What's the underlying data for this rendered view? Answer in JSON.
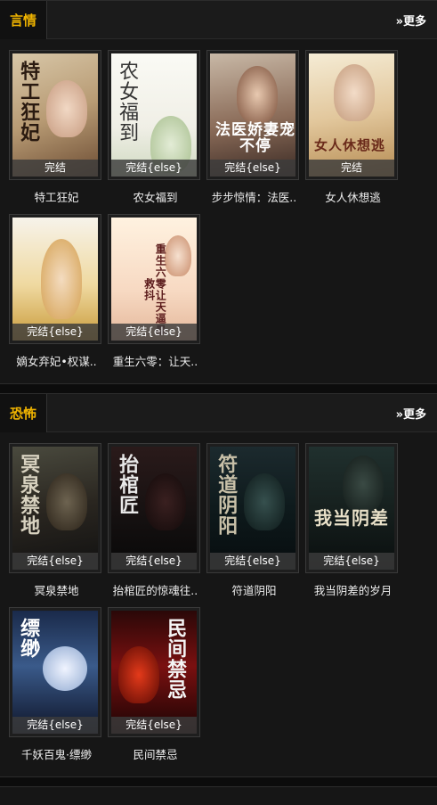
{
  "sections": [
    {
      "title": "言情",
      "more": "»更多",
      "books": [
        {
          "title": "特工狂妃",
          "status": "完结",
          "cover_text": "特工狂妃"
        },
        {
          "title": "农女福到",
          "status": "完结{else}",
          "cover_text": "农女福到"
        },
        {
          "title": "步步惊情：法医..",
          "status": "完结{else}",
          "cover_text": "法医娇妻宠不停"
        },
        {
          "title": "女人休想逃",
          "status": "完结",
          "cover_text": "女人休想逃"
        },
        {
          "title": "嫡女弃妃•权谋..",
          "status": "完结{else}",
          "cover_text": ""
        },
        {
          "title": "重生六零：让天..",
          "status": "完结{else}",
          "cover_text": "重生六零让天逼暴救抖"
        }
      ]
    },
    {
      "title": "恐怖",
      "more": "»更多",
      "books": [
        {
          "title": "冥泉禁地",
          "status": "完结{else}",
          "cover_text": "冥泉禁地"
        },
        {
          "title": "抬棺匠的惊魂往..",
          "status": "完结{else}",
          "cover_text": "抬棺匠"
        },
        {
          "title": "符道阴阳",
          "status": "完结{else}",
          "cover_text": "符道阴阳"
        },
        {
          "title": "我当阴差的岁月",
          "status": "完结{else}",
          "cover_text": "我当阴差"
        },
        {
          "title": "千妖百鬼·缥缈",
          "status": "完结{else}",
          "cover_text": "缥缈"
        },
        {
          "title": "民间禁忌",
          "status": "完结{else}",
          "cover_text": "民间禁忌"
        }
      ]
    }
  ]
}
